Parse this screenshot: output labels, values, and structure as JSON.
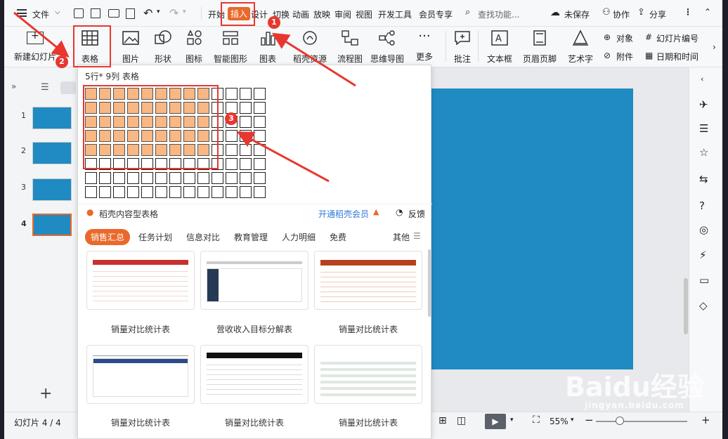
{
  "menubar": {
    "file_menu": "文件",
    "tabs": [
      "开始",
      "插入",
      "设计",
      "切换",
      "动画",
      "放映",
      "审阅",
      "视图",
      "开发工具",
      "会员专享"
    ],
    "active_tab": "插入",
    "search_placeholder": "查找功能...",
    "unsaved": "未保存",
    "collab": "协作",
    "share": "分享"
  },
  "ribbon": {
    "buttons": [
      "新建幻灯片",
      "表格",
      "图片",
      "形状",
      "图标",
      "智能图形",
      "图表",
      "稻壳资源",
      "流程图",
      "思维导图",
      "更多",
      "批注",
      "文本框",
      "页眉页脚",
      "艺术字"
    ],
    "small": {
      "object": "对象",
      "slide_number": "幻灯片编号",
      "attachment": "附件",
      "datetime": "日期和时间"
    }
  },
  "table_dropdown": {
    "size_label": "5行* 9列 表格",
    "rows": 8,
    "cols": 13,
    "selected_rows": 5,
    "selected_cols": 9,
    "content_table_label": "稻壳内容型表格",
    "member_link": "开通稻壳会员",
    "feedback": "反馈",
    "categories": [
      "销售汇总",
      "任务计划",
      "信息对比",
      "教育管理",
      "人力明细",
      "免费"
    ],
    "other": "其他",
    "templates": [
      {
        "name": "销量对比统计表"
      },
      {
        "name": "营收收入目标分解表"
      },
      {
        "name": "销量对比统计表"
      },
      {
        "name": "销量对比统计表"
      },
      {
        "name": "销量对比统计表"
      },
      {
        "name": "销量对比统计表"
      }
    ]
  },
  "slides": [
    "1",
    "2",
    "3",
    "4"
  ],
  "status": {
    "slide_info": "幻灯片 4 / 4",
    "zoom": "55%"
  },
  "annotations": [
    "1",
    "2",
    "3"
  ],
  "watermark": {
    "brand": "Baidu经验",
    "url": "jingyan.baidu.com"
  },
  "colors": {
    "accent": "#e9692b",
    "selected_cell": "#f8b783",
    "slide_blue": "#1f8bc2",
    "annotation_red": "#e8372f"
  }
}
